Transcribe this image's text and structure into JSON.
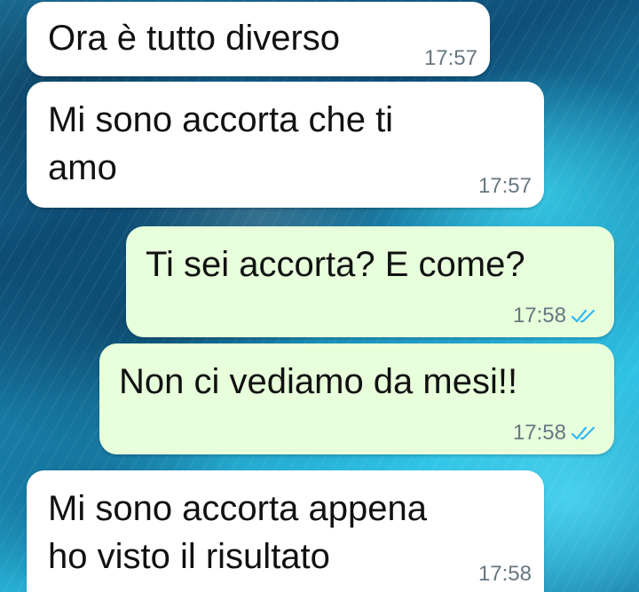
{
  "colors": {
    "incoming_bubble": "#ffffff",
    "outgoing_bubble": "#e7ffdb",
    "timestamp": "#667781",
    "read_ticks": "#34b7f1"
  },
  "messages": [
    {
      "direction": "incoming",
      "lines": [
        "Ora è tutto diverso"
      ],
      "time": "17:57"
    },
    {
      "direction": "incoming",
      "lines": [
        "Mi sono accorta che ti",
        "amo"
      ],
      "time": "17:57"
    },
    {
      "direction": "outgoing",
      "lines": [
        "Ti sei accorta? E come?"
      ],
      "time": "17:58",
      "status_icon": "double-check-read-icon"
    },
    {
      "direction": "outgoing",
      "lines": [
        "Non ci vediamo da mesi!!"
      ],
      "time": "17:58",
      "status_icon": "double-check-read-icon"
    },
    {
      "direction": "incoming",
      "lines": [
        "Mi sono accorta appena",
        "ho visto il risultato"
      ],
      "time": "17:58"
    }
  ]
}
